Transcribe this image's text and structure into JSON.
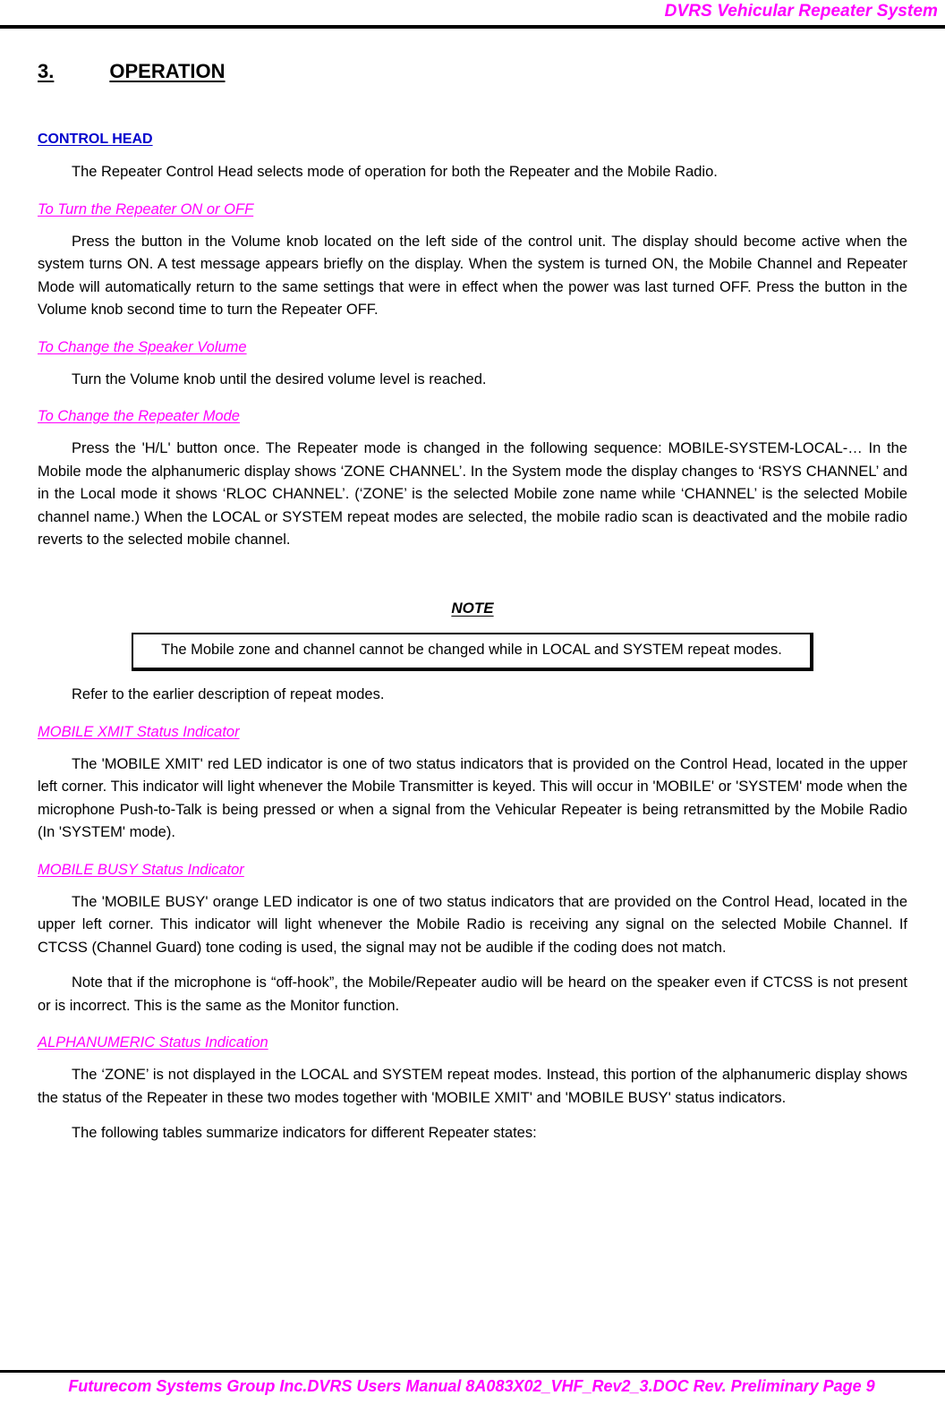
{
  "header": {
    "title": "DVRS Vehicular Repeater System"
  },
  "section": {
    "number": "3.",
    "title": "OPERATION"
  },
  "control_head": {
    "heading": "CONTROL HEAD",
    "intro": "The Repeater Control Head selects mode of operation for both the Repeater and the Mobile Radio."
  },
  "subsections": [
    {
      "heading": "To Turn the Repeater ON or OFF",
      "body": "Press the button in the Volume knob located on the left side of the control unit. The display should become active when the system turns ON. A test message appears briefly on the display. When the system is turned ON, the Mobile Channel and Repeater Mode will automatically return to the same settings that were in effect when the power was last turned OFF. Press the button in the Volume knob second time to turn the Repeater OFF."
    },
    {
      "heading": "To Change the Speaker Volume",
      "body": "Turn the Volume knob until the desired volume level is reached."
    },
    {
      "heading": "To Change the Repeater Mode",
      "body": "Press the 'H/L' button once. The Repeater mode is changed in the following sequence: MOBILE-SYSTEM-LOCAL-… In the Mobile mode the alphanumeric display shows ‘ZONE CHANNEL’. In the System mode the display changes to ‘RSYS CHANNEL’ and in the Local mode it shows ‘RLOC CHANNEL’. (‘ZONE’ is the selected Mobile zone name while ‘CHANNEL’ is the selected Mobile channel name.) When the LOCAL or SYSTEM repeat modes are selected, the mobile radio scan is deactivated and the mobile radio reverts to the selected mobile channel."
    },
    {
      "heading": "MOBILE XMIT Status Indicator",
      "body": "The 'MOBILE XMIT' red LED indicator is one of two status indicators that is provided on the Control Head, located in the upper left corner. This indicator will light whenever the Mobile Transmitter is keyed. This will occur in 'MOBILE' or 'SYSTEM' mode when the microphone Push-to-Talk is being pressed or when a signal from the Vehicular Repeater is being retransmitted by the Mobile Radio (In 'SYSTEM' mode)."
    },
    {
      "heading": "MOBILE BUSY Status Indicator",
      "body": "The 'MOBILE BUSY' orange LED indicator is one of two status indicators that are provided on the Control Head, located in the upper left corner. This indicator will light whenever the Mobile Radio is receiving any signal on the selected Mobile Channel. If CTCSS (Channel Guard) tone coding is used, the signal may not be audible if the coding does not match.",
      "body2": "Note that if the microphone is “off-hook”, the Mobile/Repeater audio will be heard on the speaker even if CTCSS is not present or is incorrect. This is the same as the Monitor function."
    },
    {
      "heading": "ALPHANUMERIC Status Indication",
      "body": "The ‘ZONE’ is not displayed in the LOCAL and SYSTEM repeat modes. Instead, this portion of the alphanumeric display shows the status of the Repeater in these two modes together with 'MOBILE XMIT' and 'MOBILE BUSY' status indicators.",
      "body2": "The following tables summarize indicators for different Repeater states:"
    }
  ],
  "note": {
    "title": "NOTE",
    "text": "The Mobile zone and channel cannot be changed while in LOCAL and SYSTEM repeat modes.",
    "after": "Refer to the earlier description of repeat modes."
  },
  "footer": {
    "text": "Futurecom Systems Group Inc.DVRS Users Manual 8A083X02_VHF_Rev2_3.DOC Rev. Preliminary  Page 9"
  },
  "colors": {
    "accent_magenta": "#FF00FF",
    "heading_blue": "#0000CC",
    "text_black": "#000000"
  }
}
